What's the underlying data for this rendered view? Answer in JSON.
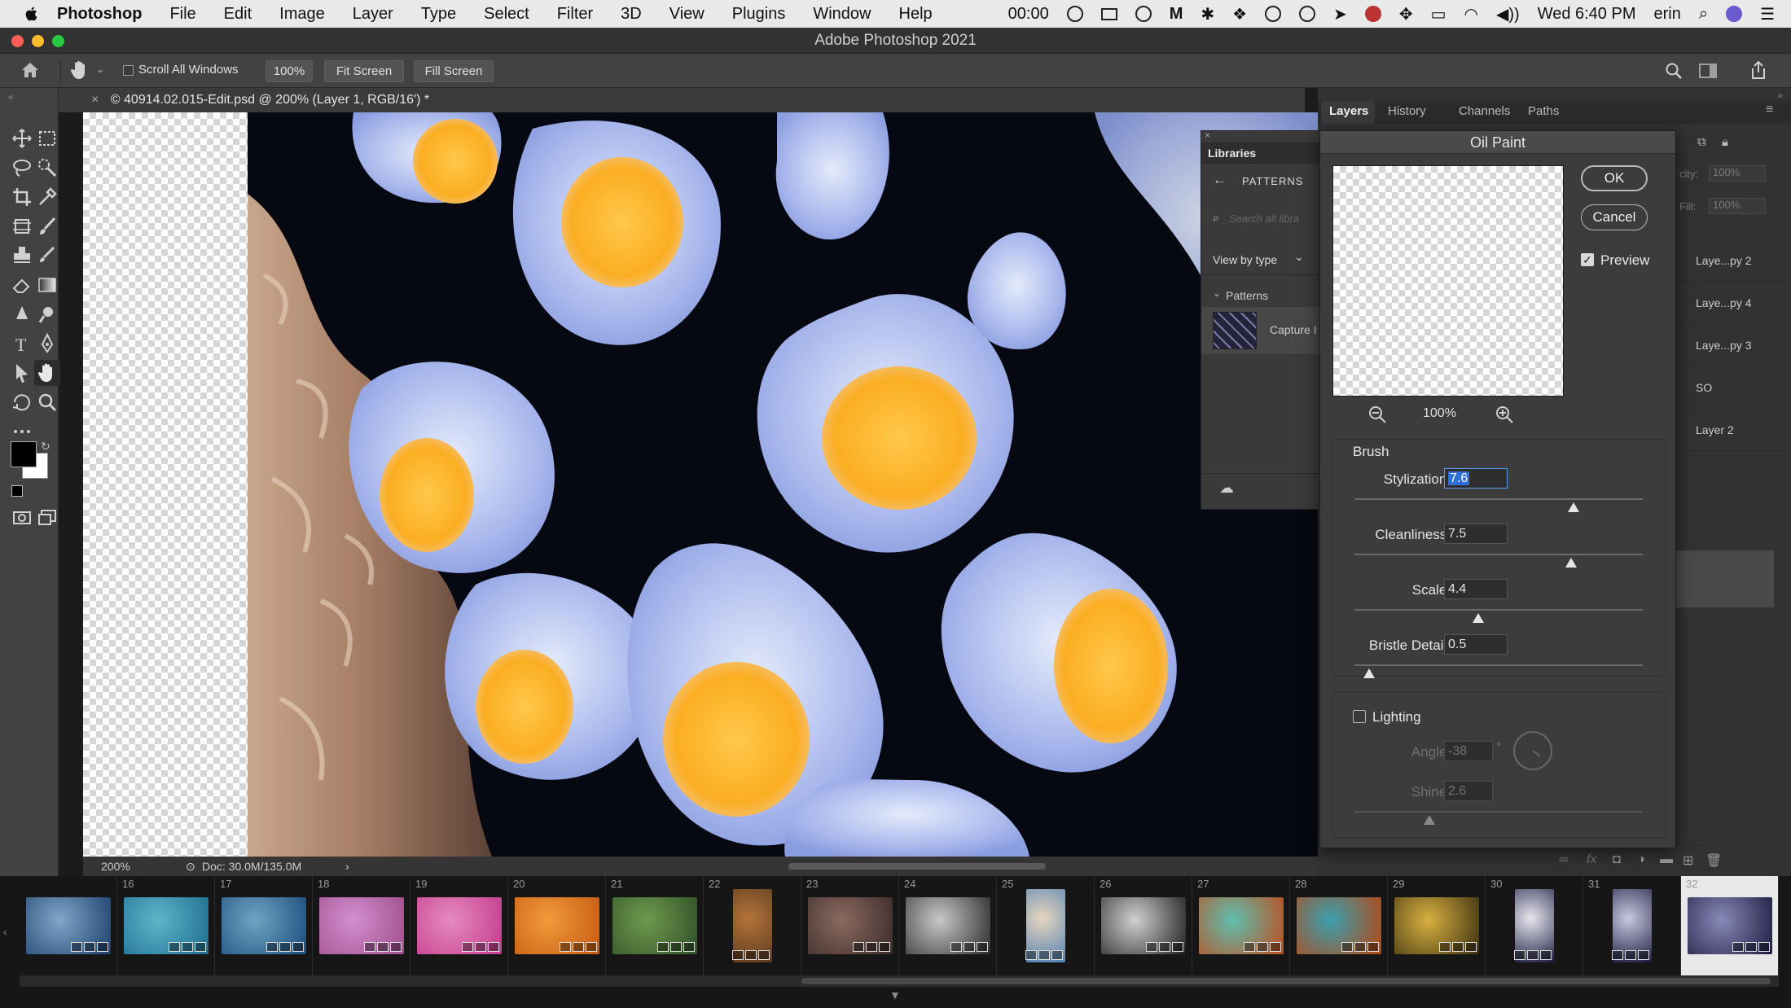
{
  "menubar": {
    "app_name": "Photoshop",
    "items": [
      "File",
      "Edit",
      "Image",
      "Layer",
      "Type",
      "Select",
      "Filter",
      "3D",
      "View",
      "Plugins",
      "Window",
      "Help"
    ],
    "timer": "00:00",
    "clock": "Wed 6:40 PM",
    "user": "erin"
  },
  "window": {
    "title": "Adobe Photoshop 2021"
  },
  "options": {
    "scroll_all_windows": "Scroll All Windows",
    "zoom": "100%",
    "fit_screen": "Fit Screen",
    "fill_screen": "Fill Screen"
  },
  "document": {
    "tab_title": "© 40914.02.015-Edit.psd @ 200% (Layer 1, RGB/16') *",
    "zoom": "200%",
    "doc_size": "Doc: 30.0M/135.0M"
  },
  "panels": {
    "tabs": [
      "Layers",
      "History",
      "Channels",
      "Paths"
    ],
    "opacity_label": "city:",
    "opacity_value": "100%",
    "fill_label": "Fill:",
    "fill_value": "100%",
    "layers": [
      "Laye...py 2",
      "Laye...py 4",
      "Laye...py 3",
      "SO",
      "Layer 2"
    ]
  },
  "libraries": {
    "title": "Libraries",
    "section": "PATTERNS",
    "search_placeholder": "Search all libra",
    "view_by": "View by type",
    "group": "Patterns",
    "item": "Capture I"
  },
  "oil_paint": {
    "title": "Oil Paint",
    "ok": "OK",
    "cancel": "Cancel",
    "preview_label": "Preview",
    "preview_checked": true,
    "zoom": "100%",
    "brush_group": "Brush",
    "params": [
      {
        "label": "Stylization:",
        "value": "7.6",
        "fraction": 0.76
      },
      {
        "label": "Cleanliness:",
        "value": "7.5",
        "fraction": 0.75
      },
      {
        "label": "Scale:",
        "value": "4.4",
        "fraction": 0.43
      },
      {
        "label": "Bristle Detail:",
        "value": "0.5",
        "fraction": 0.05
      }
    ],
    "lighting_label": "Lighting",
    "lighting_checked": false,
    "angle_label": "Angle:",
    "angle_value": "-38",
    "angle_unit": "°",
    "shine_label": "Shine:",
    "shine_value": "2.6",
    "shine_fraction": 0.26
  },
  "filmstrip": {
    "frames": [
      {
        "num": "",
        "colors": [
          "#1b3f6b",
          "#7fa6c8"
        ]
      },
      {
        "num": "16",
        "colors": [
          "#1d6d8f",
          "#5fb4c9"
        ]
      },
      {
        "num": "17",
        "colors": [
          "#1a4c7a",
          "#6fa4c4"
        ]
      },
      {
        "num": "18",
        "colors": [
          "#a04c8a",
          "#d18fd0"
        ]
      },
      {
        "num": "19",
        "colors": [
          "#c43a8a",
          "#e58ac0"
        ]
      },
      {
        "num": "20",
        "colors": [
          "#c45a10",
          "#f29a3a"
        ]
      },
      {
        "num": "21",
        "colors": [
          "#2f4f2a",
          "#6f9a4c"
        ]
      },
      {
        "num": "22",
        "colors": [
          "#5a3a1e",
          "#b3743a"
        ]
      },
      {
        "num": "23",
        "colors": [
          "#3a2a28",
          "#8a6a60"
        ]
      },
      {
        "num": "24",
        "colors": [
          "#2a2a2a",
          "#c8c8c8"
        ]
      },
      {
        "num": "25",
        "colors": [
          "#4f7fb0",
          "#e8d6c0"
        ]
      },
      {
        "num": "26",
        "colors": [
          "#1e1e1e",
          "#d0d0d0"
        ]
      },
      {
        "num": "27",
        "colors": [
          "#c04a1a",
          "#5fbfb0"
        ]
      },
      {
        "num": "28",
        "colors": [
          "#b8440f",
          "#3aa0b0"
        ]
      },
      {
        "num": "29",
        "colors": [
          "#3a3010",
          "#d8b040"
        ]
      },
      {
        "num": "30",
        "colors": [
          "#1a1a40",
          "#e8e8f0"
        ]
      },
      {
        "num": "31",
        "colors": [
          "#1a1a40",
          "#c8c8e0"
        ]
      },
      {
        "num": "32",
        "colors": [
          "#1a1a40",
          "#8a8ab8"
        ]
      }
    ]
  }
}
